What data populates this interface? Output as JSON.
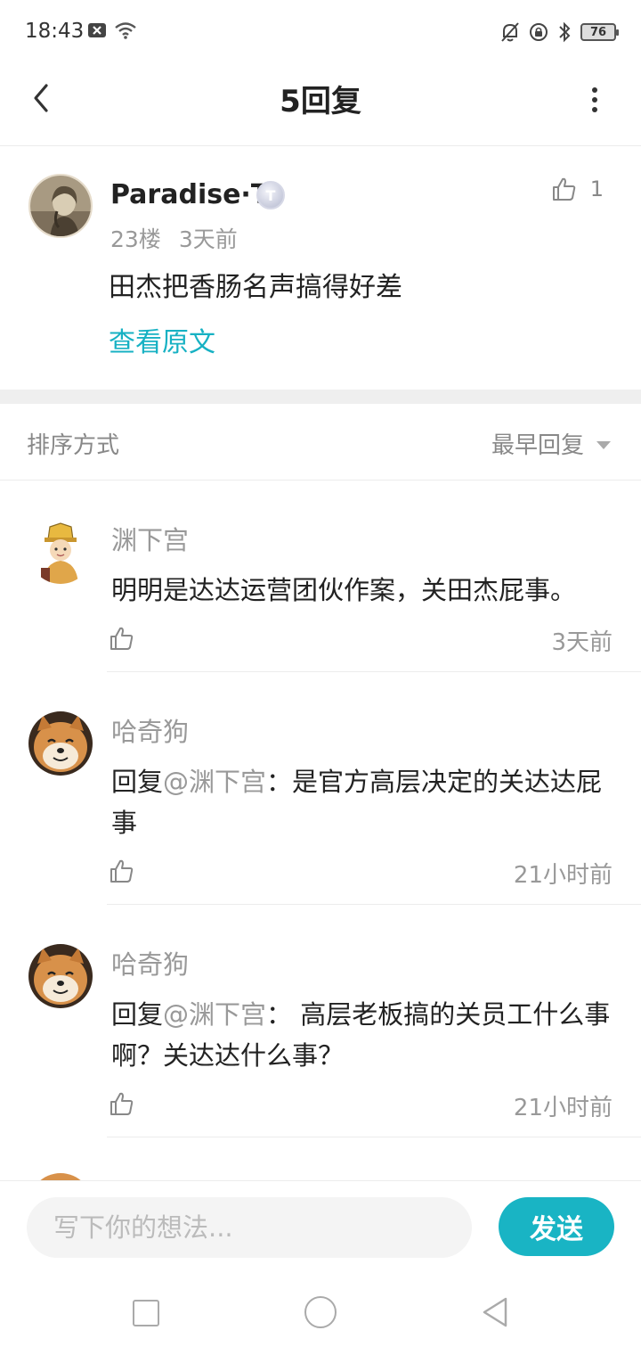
{
  "status_bar": {
    "time": "18:43",
    "battery": "76",
    "icons_left": [
      "notification-x-icon",
      "wifi-icon"
    ],
    "icons_right": [
      "mute-bell-icon",
      "rotation-lock-icon",
      "bluetooth-icon",
      "battery-icon"
    ]
  },
  "header": {
    "title": "5回复"
  },
  "post": {
    "author": "Paradise·T",
    "level_badge": "T",
    "floor": "23楼",
    "time": "3天前",
    "like_count": "1",
    "text": "田杰把香肠名声搞得好差",
    "view_original": "查看原文"
  },
  "sort": {
    "label": "排序方式",
    "selected": "最早回复"
  },
  "replies": [
    {
      "author": "渊下宫",
      "text": "明明是达达运营团伙作案，关田杰屁事。",
      "time": "3天前"
    },
    {
      "author": "哈奇狗",
      "prefix": "回复",
      "mention": "@渊下宫",
      "text": "：是官方高层决定的关达达屁事",
      "time": "21小时前"
    },
    {
      "author": "哈奇狗",
      "prefix": "回复",
      "mention": "@渊下宫",
      "text": "： 高层老板搞的关员工什么事啊？关达达什么事？",
      "time": "21小时前"
    }
  ],
  "composer": {
    "placeholder": "写下你的想法...",
    "send_label": "发送"
  },
  "colors": {
    "accent": "#19b4c4",
    "link": "#17b1c3"
  }
}
